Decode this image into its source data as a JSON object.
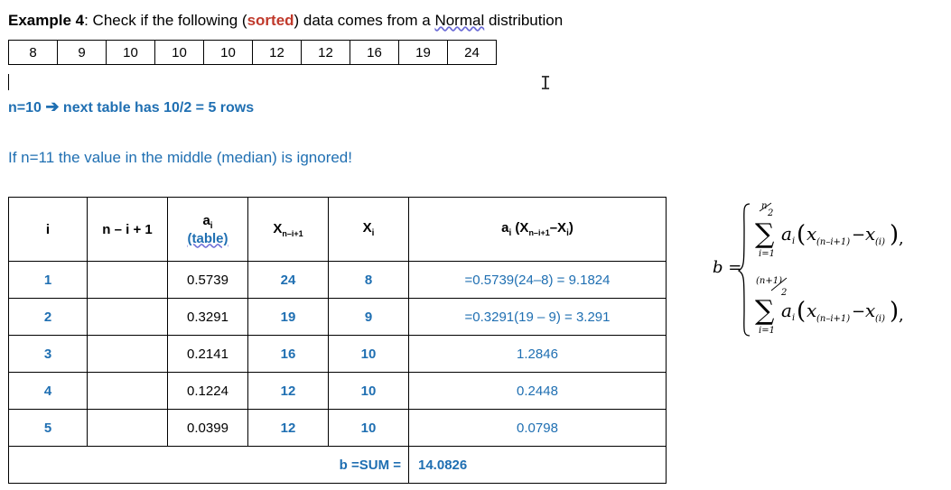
{
  "title": {
    "example": "Example 4",
    "text_before": ": Check if the following (",
    "sorted": "sorted",
    "text_mid": ") data comes from a ",
    "normal": "Normal",
    "text_after": " distribution"
  },
  "data_values": [
    "8",
    "9",
    "10",
    "10",
    "10",
    "12",
    "12",
    "16",
    "19",
    "24"
  ],
  "note_n10_left": "n=10",
  "note_n10_right": "next table has 10/2 = 5 rows",
  "note_n11": "If n=11 the value in the middle (median) is ignored!",
  "table": {
    "headers": {
      "i": "i",
      "nmi": "n – i + 1",
      "ai": "a",
      "ai_sub": "i",
      "ai_table": "(table)",
      "xn": "X",
      "xn_sub": "n–i+1",
      "xi": "X",
      "xi_sub": "i",
      "prod": "a",
      "prod_rest": " (X",
      "prod_sub": "n–i+1",
      "prod_end": "–X",
      "prod_end_sub": "i",
      "prod_close": ")"
    },
    "rows": [
      {
        "i": "1",
        "a": "0.5739",
        "xn": "24",
        "xi": "8",
        "p": "=0.5739(24–8) = 9.1824"
      },
      {
        "i": "2",
        "a": "0.3291",
        "xn": "19",
        "xi": "9",
        "p": "=0.3291(19 – 9)  = 3.291"
      },
      {
        "i": "3",
        "a": "0.2141",
        "xn": "16",
        "xi": "10",
        "p": "1.2846"
      },
      {
        "i": "4",
        "a": "0.1224",
        "xn": "12",
        "xi": "10",
        "p": "0.2448"
      },
      {
        "i": "5",
        "a": "0.0399",
        "xn": "12",
        "xi": "10",
        "p": "0.0798"
      }
    ],
    "sum_label": "b =SUM =",
    "sum_value": "14.0826"
  },
  "formula": {
    "b": "b =",
    "a": "a",
    "i": "i",
    "x": "x",
    "sub_n": "(n–i+1)",
    "sub_i": "(i)",
    "n": "n",
    "two": "2",
    "n1": "(n+1)",
    "lower": "i=1",
    "comma": ","
  }
}
